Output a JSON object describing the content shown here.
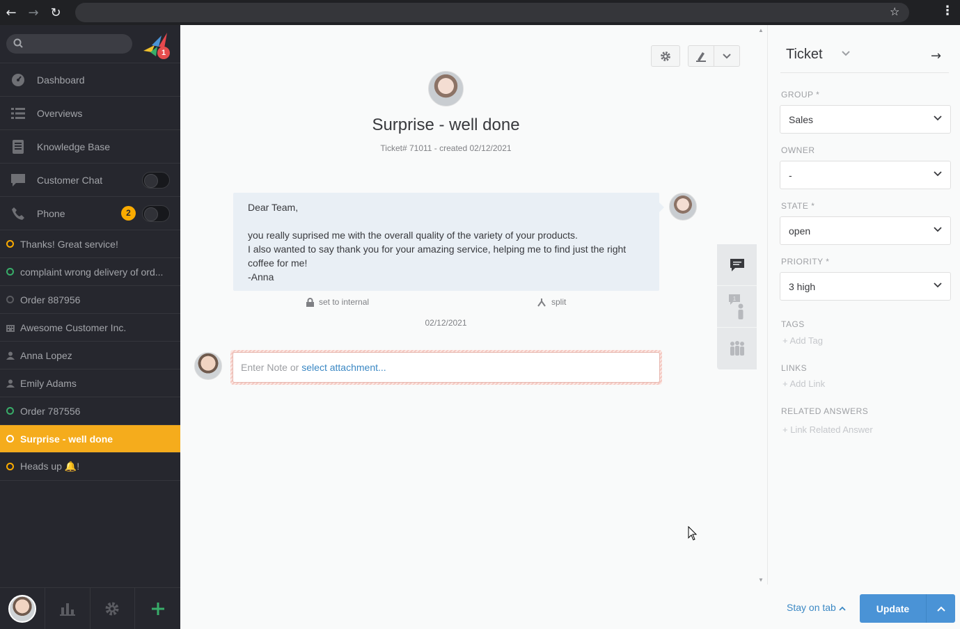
{
  "browser": {
    "back_icon": "arrow-left-icon",
    "forward_icon": "arrow-right-icon",
    "reload_icon": "reload-icon",
    "star_icon": "star-icon",
    "menu_icon": "kebab-menu-icon"
  },
  "sidebar": {
    "logo_badge": "1",
    "nav": [
      {
        "label": "Dashboard",
        "icon": "dashboard-icon"
      },
      {
        "label": "Overviews",
        "icon": "list-icon"
      },
      {
        "label": "Knowledge Base",
        "icon": "book-icon"
      },
      {
        "label": "Customer Chat",
        "icon": "chat-icon",
        "toggle": false
      },
      {
        "label": "Phone",
        "icon": "phone-icon",
        "badge": "2",
        "toggle": false
      }
    ],
    "tabs": [
      {
        "label": "Thanks! Great service!",
        "status": "yellow"
      },
      {
        "label": "complaint wrong delivery of ord...",
        "status": "green"
      },
      {
        "label": "Order 887956",
        "status": "grey"
      },
      {
        "label": "Awesome Customer Inc.",
        "status": "organization"
      },
      {
        "label": "Anna Lopez",
        "status": "user"
      },
      {
        "label": "Emily Adams",
        "status": "user"
      },
      {
        "label": "Order 787556",
        "status": "green"
      },
      {
        "label": "Surprise - well done",
        "status": "active"
      },
      {
        "label": "Heads up 🔔!",
        "status": "yellow"
      }
    ]
  },
  "ticket": {
    "title": "Surprise - well done",
    "meta": "Ticket# 71011 - created 02/12/2021",
    "article_body": "Dear Team,\n\nyou really suprised me with the overall quality of the variety of your products.\nI also wanted to say thank you for your amazing service, helping me to find just the right coffee for me!\n-Anna",
    "set_internal": "set to internal",
    "split": "split",
    "article_date": "02/12/2021",
    "reply_placeholder": "Enter Note or",
    "reply_attachment": "select attachment..."
  },
  "panel": {
    "title": "Ticket",
    "fields": {
      "group_label": "GROUP *",
      "group_value": "Sales",
      "owner_label": "OWNER",
      "owner_value": "-",
      "state_label": "STATE *",
      "state_value": "open",
      "priority_label": "PRIORITY *",
      "priority_value": "3 high"
    },
    "tags_label": "TAGS",
    "add_tag": "+ Add Tag",
    "links_label": "LINKS",
    "add_link": "+ Add Link",
    "related_label": "RELATED ANSWERS",
    "link_related": "+ Link Related Answer"
  },
  "bottom": {
    "stay_on_tab": "Stay on tab",
    "update": "Update"
  },
  "colors": {
    "sidebar_bg": "#26272e",
    "active_tab": "#f5ac1c",
    "accent_blue": "#4a93d6",
    "status_yellow": "#faab00",
    "status_green": "#38ad69"
  }
}
